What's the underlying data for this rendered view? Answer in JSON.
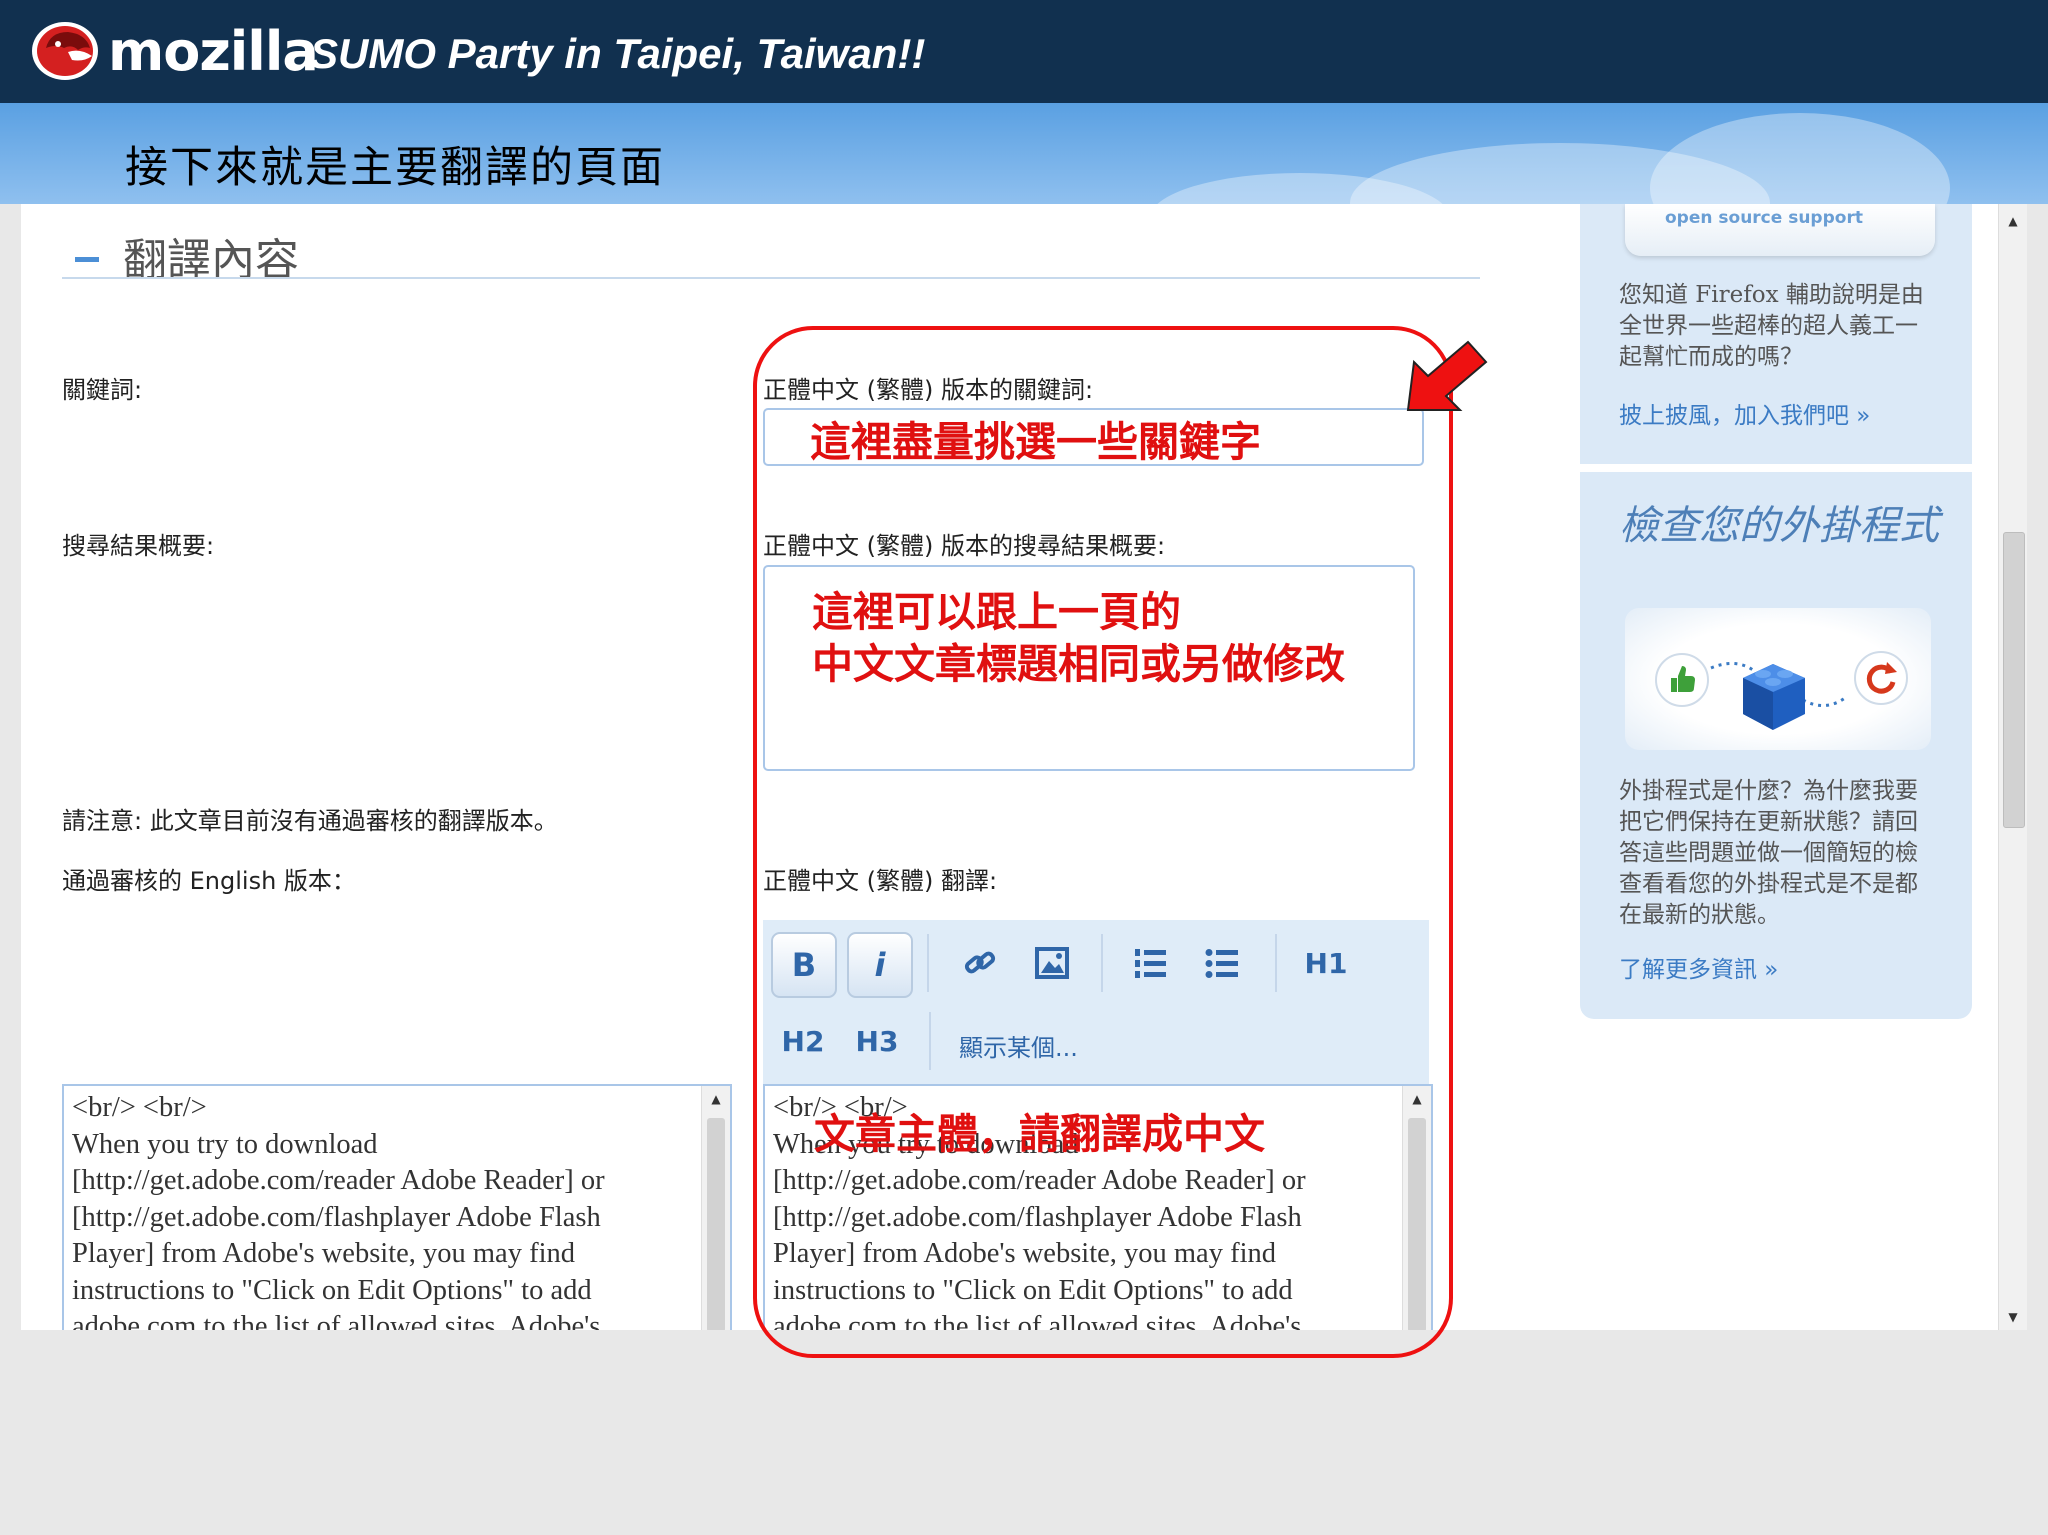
{
  "slide": {
    "logo_text": "mozilla",
    "title": "SUMO Party in Taipei, Taiwan!!",
    "heading": "接下來就是主要翻譯的頁面"
  },
  "section": {
    "title": "翻譯內容"
  },
  "labels": {
    "keywords": "關鍵詞:",
    "keywords_zh": "正體中文 (繁體) 版本的關鍵詞:",
    "summary": "搜尋結果概要:",
    "summary_zh": "正體中文 (繁體) 版本的搜尋結果概要:",
    "notice": "請注意: 此文章目前沒有通過審核的翻譯版本。",
    "approved": "通過審核的 English 版本：",
    "translation_zh": "正體中文 (繁體) 翻譯:"
  },
  "toolbar": {
    "bold": "B",
    "italic": "i",
    "h1": "H1",
    "h2": "H2",
    "h3": "H3",
    "show_more": "顯示某個..."
  },
  "source_text": "<br/> <br/>\nWhen you try to download\n[http://get.adobe.com/reader Adobe Reader] or\n[http://get.adobe.com/flashplayer Adobe Flash\nPlayer] from Adobe's website, you may find\ninstructions to \"Click on Edit Options\" to add\nadobe.com to the list of allowed sites. Adobe's",
  "translation_text": "<br/> <br/>\nWhen you try to download\n[http://get.adobe.com/reader Adobe Reader] or\n[http://get.adobe.com/flashplayer Adobe Flash\nPlayer] from Adobe's website, you may find\ninstructions to \"Click on Edit Options\" to add\nadobe.com to the list of allowed sites. Adobe's",
  "sidebar": {
    "badge": "open source support",
    "promo_text": "您知道 Firefox 輔助說明是由全世界一些超棒的超人義工一起幫忙而成的嗎？",
    "promo_link": "披上披風，加入我們吧 »",
    "addon_title": "檢查您的外掛程式",
    "addon_text": "外掛程式是什麼？為什麼我要把它們保持在更新狀態？請回答這些問題並做一個簡短的檢查看看您的外掛程式是不是都在最新的狀態。",
    "addon_link": "了解更多資訊 »"
  },
  "annotations": {
    "keywords_hint": "這裡盡量挑選一些關鍵字",
    "summary_hint_1": "這裡可以跟上一頁的",
    "summary_hint_2": "中文文章標題相同或另做修改",
    "body_hint": "文章主體，請翻譯成中文"
  },
  "colors": {
    "topbar": "#11304f",
    "accent": "#2f66a8",
    "annotation": "#e01010"
  }
}
